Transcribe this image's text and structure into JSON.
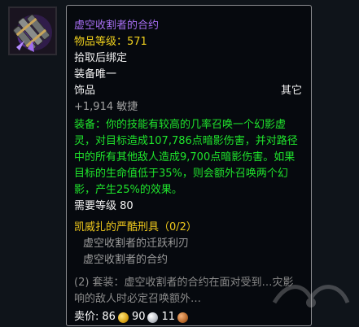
{
  "tooltip": {
    "item_name": "虚空收割者的合约",
    "item_level": "物品等级：571",
    "bind": "拾取后绑定",
    "unique": "装备唯一",
    "slot": "饰品",
    "type": "其它",
    "stat": "+1,914 敏捷",
    "equip_effect": "装备：你的技能有较高的几率召唤一个幻影虚灵，对目标造成107,786点暗影伤害，并对路径中的所有其他敌人造成9,700点暗影伤害。如果目标的生命值低于35%，则会额外召唤两个幻影，产生25%的效果。",
    "required_level": "需要等级 80",
    "set_name": "凯威扎的严酷刑具（0/2）",
    "set_items": [
      "虚空收割者的迁跃利刃",
      "虚空收割者的合约"
    ],
    "set_bonus": "(2) 套装：虚空收割者的合约在面对受到…灾影响的敌人时必定召唤额外…",
    "sell_label": "卖价:",
    "sell_gold": "86",
    "sell_silver": "90",
    "sell_copper": "11"
  },
  "colors": {
    "title": "#a76ef2",
    "item_level": "#f0d11d",
    "equip": "#1fe52c",
    "set_name": "#efc81c"
  },
  "icons": {
    "item": "void-reaver-contract-trinket-icon",
    "gold": "gold-coin-icon",
    "silver": "silver-coin-icon",
    "copper": "copper-coin-icon"
  }
}
